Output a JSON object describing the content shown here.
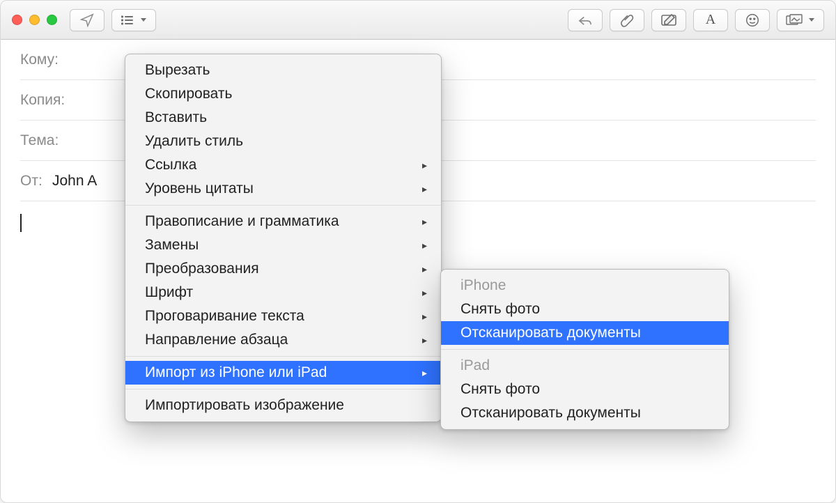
{
  "fields": {
    "to_label": "Кому:",
    "cc_label": "Копия:",
    "subject_label": "Тема:",
    "from_label": "От:",
    "from_value": "John A"
  },
  "context_menu": {
    "items": [
      {
        "label": "Вырезать",
        "submenu": false
      },
      {
        "label": "Скопировать",
        "submenu": false
      },
      {
        "label": "Вставить",
        "submenu": false
      },
      {
        "label": "Удалить стиль",
        "submenu": false
      },
      {
        "label": "Ссылка",
        "submenu": true
      },
      {
        "label": "Уровень цитаты",
        "submenu": true
      }
    ],
    "items2": [
      {
        "label": "Правописание и грамматика",
        "submenu": true
      },
      {
        "label": "Замены",
        "submenu": true
      },
      {
        "label": "Преобразования",
        "submenu": true
      },
      {
        "label": "Шрифт",
        "submenu": true
      },
      {
        "label": "Проговаривание текста",
        "submenu": true
      },
      {
        "label": "Направление абзаца",
        "submenu": true
      }
    ],
    "import_item": {
      "label": "Импорт из iPhone или iPad",
      "submenu": true,
      "highlighted": true
    },
    "items3": [
      {
        "label": "Импортировать изображение",
        "submenu": false
      }
    ]
  },
  "submenu": {
    "header1": "iPhone",
    "group1": [
      {
        "label": "Снять фото",
        "highlighted": false
      },
      {
        "label": "Отсканировать документы",
        "highlighted": true
      }
    ],
    "header2": "iPad",
    "group2": [
      {
        "label": "Снять фото",
        "highlighted": false
      },
      {
        "label": "Отсканировать документы",
        "highlighted": false
      }
    ]
  }
}
